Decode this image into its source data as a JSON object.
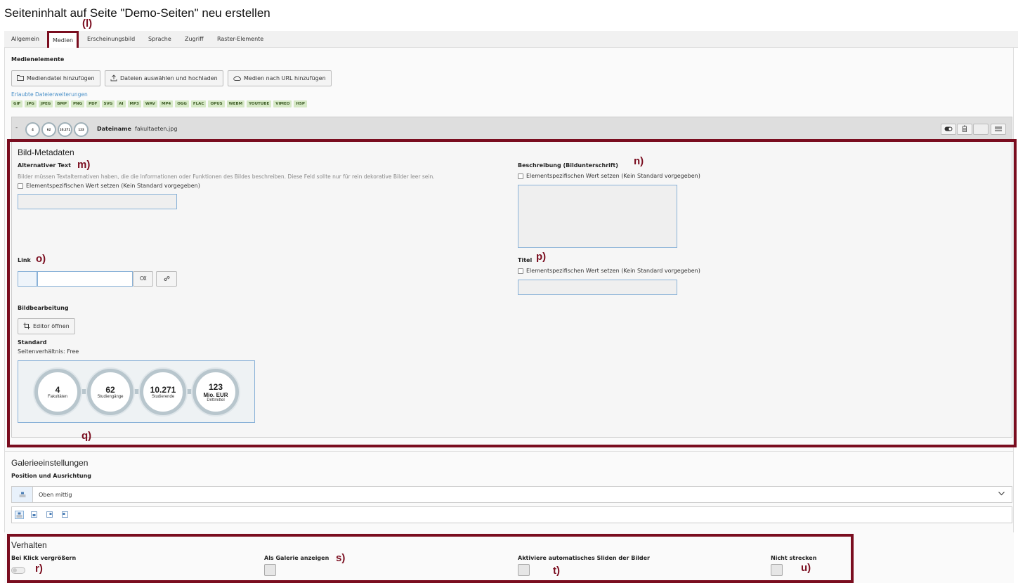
{
  "page": {
    "title": "Seiteninhalt auf Seite \"Demo-Seiten\" neu erstellen"
  },
  "tabs": [
    {
      "label": "Allgemein"
    },
    {
      "label": "Medien",
      "active": true
    },
    {
      "label": "Erscheinungsbild"
    },
    {
      "label": "Sprache"
    },
    {
      "label": "Zugriff"
    },
    {
      "label": "Raster-Elemente"
    }
  ],
  "annotations": {
    "l": "(l)",
    "m": "m)",
    "n": "n)",
    "o": "o)",
    "p": "p)",
    "q": "q)",
    "r": "r)",
    "s": "s)",
    "t": "t)",
    "u": "u)"
  },
  "media": {
    "heading": "Medienelemente",
    "buttons": {
      "add_file": "Mediendatei hinzufügen",
      "upload": "Dateien auswählen und hochladen",
      "by_url": "Medien nach URL hinzufügen"
    },
    "allowed_label": "Erlaubte Dateierweiterungen",
    "extensions": [
      "GIF",
      "JPG",
      "JPEG",
      "BMP",
      "PNG",
      "PDF",
      "SVG",
      "AI",
      "MP3",
      "WAV",
      "MP4",
      "OGG",
      "FLAC",
      "OPUS",
      "WEBM",
      "YOUTUBE",
      "VIMEO",
      "H5P"
    ],
    "file": {
      "label": "Dateiname",
      "name": "fakultaeten.jpg",
      "collapse_glyph": "-"
    },
    "thumb": [
      "4",
      "62",
      "10.271",
      "123"
    ]
  },
  "metadata": {
    "title": "Bild-Metadaten",
    "alt": {
      "label": "Alternativer Text",
      "help": "Bilder müssen Textalternativen haben, die die Informationen oder Funktionen des Bildes beschreiben. Diese Feld sollte nur für rein dekorative Bilder leer sein.",
      "checkbox": "Elementspezifischen Wert setzen (Kein Standard vorgegeben)"
    },
    "description": {
      "label": "Beschreibung (Bildunterschrift)",
      "checkbox": "Elementspezifischen Wert setzen (Kein Standard vorgegeben)"
    },
    "link": {
      "label": "Link"
    },
    "titel": {
      "label": "Titel",
      "checkbox": "Elementspezifischen Wert setzen (Kein Standard vorgegeben)"
    },
    "editing": {
      "label": "Bildbearbeitung",
      "button": "Editor öffnen",
      "variant": "Standard",
      "ratio": "Seitenverhältnis: Free"
    },
    "preview": [
      {
        "num": "4",
        "label": "Fakultäten"
      },
      {
        "num": "62",
        "label": "Studiengänge"
      },
      {
        "num": "10.271",
        "label": "Studierende"
      },
      {
        "num": "123",
        "num2": "Mio. EUR",
        "label": "Drittmittel"
      }
    ]
  },
  "gallery": {
    "title": "Galerieeinstellungen",
    "position_label": "Position und Ausrichtung",
    "selected": "Oben mittig"
  },
  "behavior": {
    "title": "Verhalten",
    "zoom": "Bei Klick vergrößern",
    "gallery": "Als Galerie anzeigen",
    "autoslide": "Aktiviere automatisches Sliden der Bilder",
    "nostretch": "Nicht strecken"
  },
  "colors": {
    "frame": "#7a0d1f",
    "extension_bg": "#d6e9c6",
    "link_blue": "#4a90c8"
  }
}
